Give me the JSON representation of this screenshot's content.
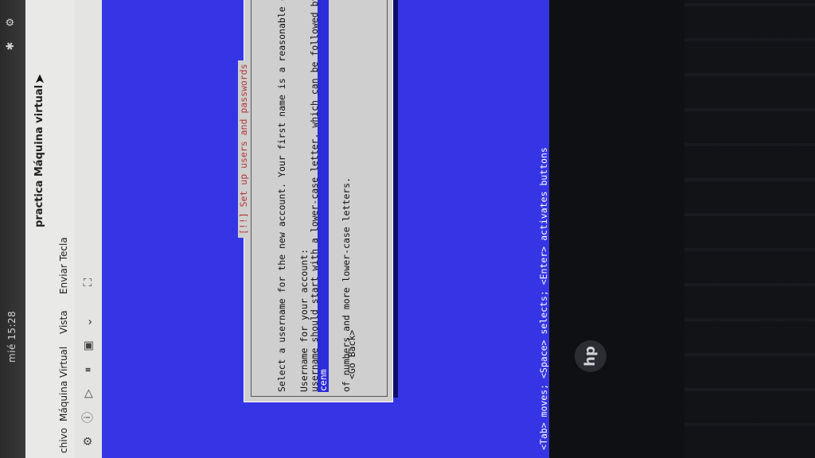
{
  "topbar": {
    "clock": "mié 15:28"
  },
  "vbox": {
    "title": "practica Máquina virtual",
    "menu": [
      "chivo",
      "Máquina Virtual",
      "Vista",
      "Enviar Tecla"
    ]
  },
  "installer": {
    "title": "[!!] Set up users and passwords",
    "text_lines": [
      "Select a username for the new account. Your first name is a reasonable choi",
      "username should start with a lower-case letter, which can be followed by an",
      "of numbers and more lower-case letters."
    ],
    "field_label": "Username for your account:",
    "username_value": "cenm",
    "go_back": "<Go Back>",
    "status": "<Tab> moves; <Space> selects; <Enter> activates buttons"
  },
  "device": {
    "logo": "hp"
  },
  "icons": [
    "bluetooth-icon",
    "settings-icon",
    "pointer-icon",
    "view-icon",
    "chevron-down-icon",
    "settings-gear-icon"
  ]
}
